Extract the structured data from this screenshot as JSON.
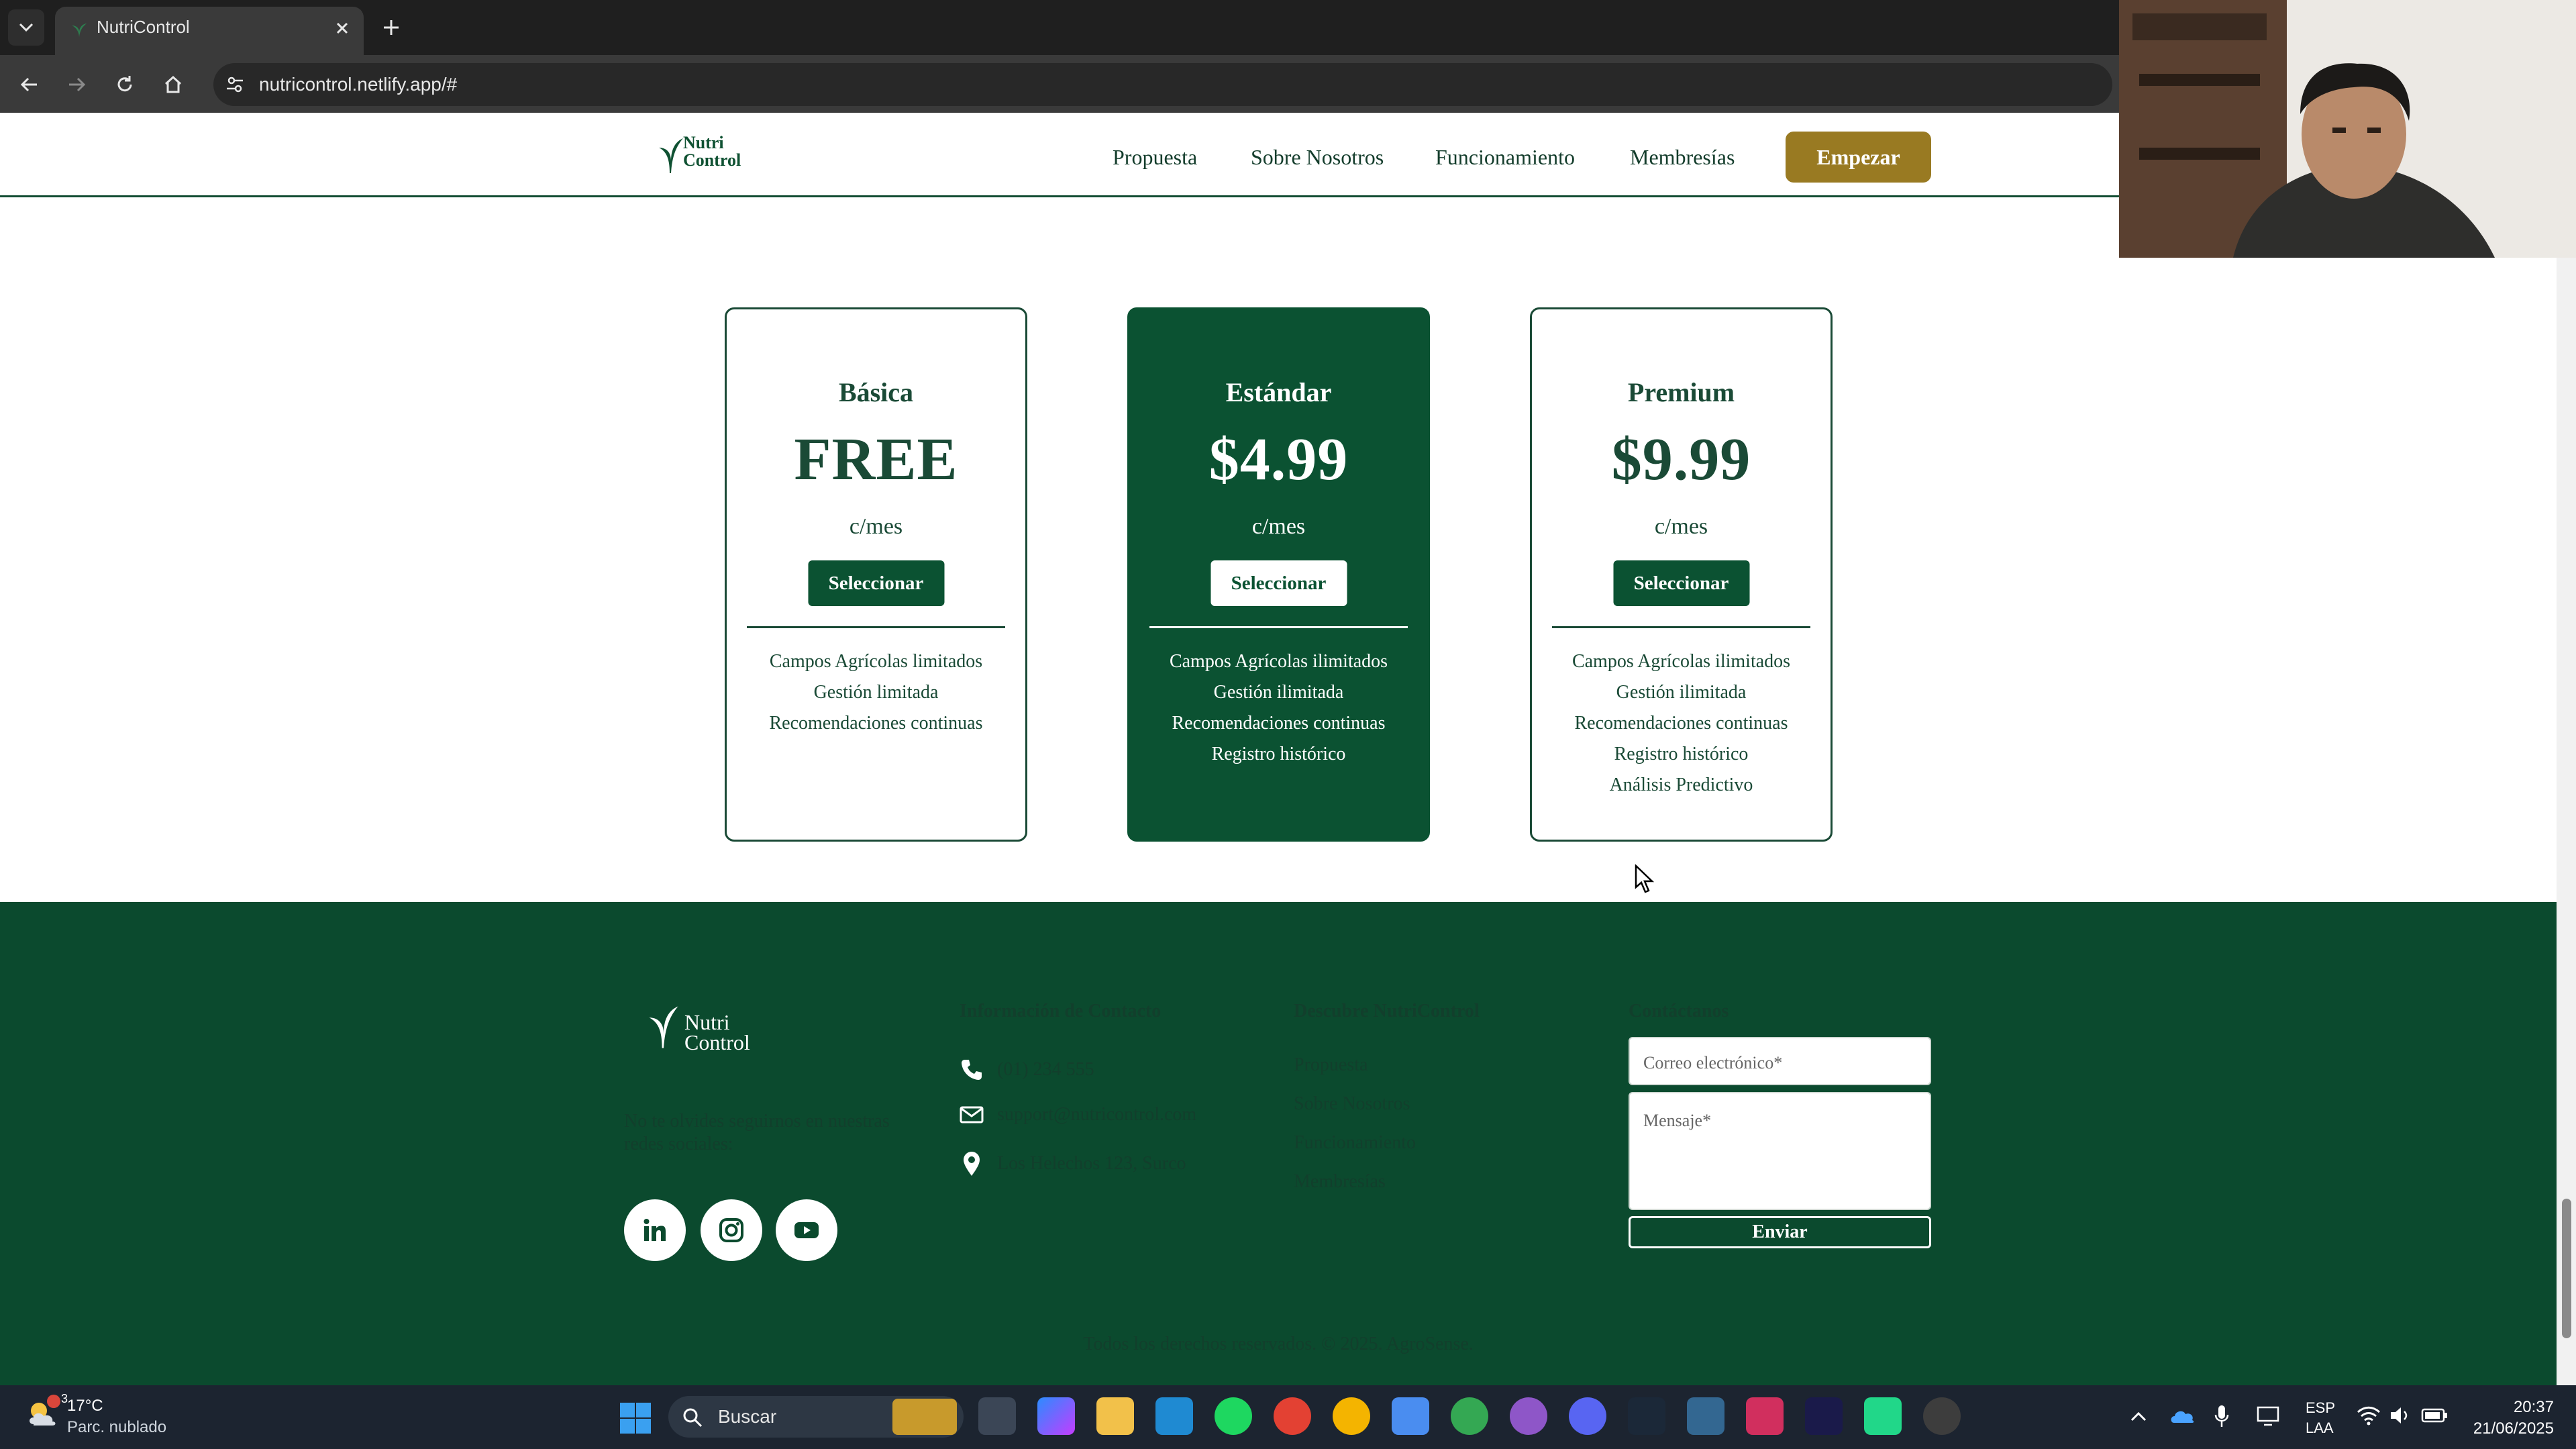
{
  "browser": {
    "tab_title": "NutriControl",
    "url": "nutricontrol.netlify.app/#"
  },
  "site": {
    "logo_line1": "Nutri",
    "logo_line2": "Control",
    "nav": [
      "Propuesta",
      "Sobre Nosotros",
      "Funcionamiento",
      "Membresías"
    ],
    "cta_label": "Empezar",
    "accent_color": "#997a22",
    "brand_color": "#0b5232"
  },
  "plans": [
    {
      "name": "Básica",
      "price": "FREE",
      "period": "c/mes",
      "button": "Seleccionar",
      "features": [
        "Campos Agrícolas limitados",
        "Gestión limitada",
        "Recomendaciones continuas"
      ]
    },
    {
      "name": "Estándar",
      "price": "$4.99",
      "period": "c/mes",
      "button": "Seleccionar",
      "featured": true,
      "features": [
        "Campos Agrícolas ilimitados",
        "Gestión ilimitada",
        "Recomendaciones continuas",
        "Registro histórico"
      ]
    },
    {
      "name": "Premium",
      "price": "$9.99",
      "period": "c/mes",
      "button": "Seleccionar",
      "features": [
        "Campos Agrícolas ilimitados",
        "Gestión ilimitada",
        "Recomendaciones continuas",
        "Registro histórico",
        "Análisis Predictivo"
      ]
    }
  ],
  "footer": {
    "logo_line1": "Nutri",
    "logo_line2": "Control",
    "follow_text": "No te olvides seguirnos en nuestras redes sociales:",
    "social_icons": [
      "linkedin-icon",
      "instagram-icon",
      "youtube-icon"
    ],
    "contact_heading": "Información de Contacto",
    "phone": "(01) 234 555",
    "email": "support@nutricontrol.com",
    "address": "Los Helechos 123, Surco",
    "discover_heading": "Descubre NutriControl",
    "links": [
      "Propuesta",
      "Sobre Nosotros",
      "Funcionamiento",
      "Membresías"
    ],
    "form_heading": "Contáctanos",
    "email_placeholder": "Correo electrónico*",
    "message_placeholder": "Mensaje*",
    "send_label": "Enviar",
    "copyright": "Todos los derechos reservados. © 2025. AgroSense."
  },
  "taskbar": {
    "weather_temp": "17°C",
    "weather_desc": "Parc. nublado",
    "weather_badge": "3",
    "search_label": "Buscar",
    "lang_line1": "ESP",
    "lang_line2": "LAA",
    "time": "20:37",
    "date": "21/06/2025",
    "apps": [
      "task-view-icon",
      "copilot-icon",
      "file-explorer-icon",
      "vscode-icon",
      "spotify-icon",
      "chrome-icon",
      "chrome-profile-icon",
      "notepad-icon",
      "chrome-profile-2-icon",
      "github-icon",
      "discord-icon",
      "steam-icon",
      "postgres-icon",
      "intellij-icon",
      "premiere-icon",
      "pycharm-icon",
      "obs-icon"
    ]
  }
}
